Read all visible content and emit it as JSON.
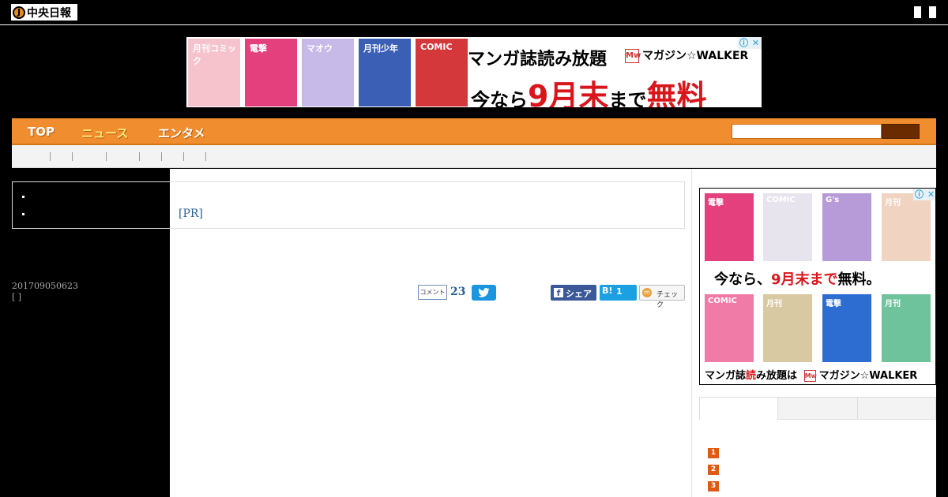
{
  "header": {
    "logo_mark": "J",
    "logo_text": "中央日報"
  },
  "top_ad": {
    "covers": [
      {
        "label": "月刊コミック",
        "color": "#f6c3cd"
      },
      {
        "label": "電撃",
        "color": "#e3407d"
      },
      {
        "label": "マオウ",
        "color": "#c7b9e8"
      },
      {
        "label": "月刊少年",
        "color": "#3c5fb6"
      },
      {
        "label": "COMIC",
        "color": "#d5383a"
      }
    ],
    "headline": "マンガ誌読み放題",
    "brand_mark": "Mw",
    "brand": "マガジン☆WALKER",
    "subline_prefix": "今なら",
    "subline_highlight": "9月末",
    "subline_mid": "まで",
    "subline_emph": "無料",
    "adchoice_info": "ⓘ",
    "adchoice_close": "✕"
  },
  "nav": {
    "items": [
      "TOP",
      "ニュース",
      "エンタメ"
    ],
    "active_index": 1
  },
  "article": {
    "pr_label": "[PR]",
    "date": "201709050623",
    "bracket": "[ ]",
    "comment_label": "コメント",
    "comment_count": "23",
    "fb_label": "シェア",
    "fb_mark": "f",
    "hatena_mark": "B!",
    "hatena_count": "1",
    "mixi_mark": "m",
    "mixi_label": "チェック"
  },
  "side_ad": {
    "covers_top": [
      {
        "label": "電撃",
        "color": "#e3407d"
      },
      {
        "label": "COMIC",
        "color": "#e7e4ee"
      },
      {
        "label": "G's",
        "color": "#b79ad8"
      },
      {
        "label": "月刊",
        "color": "#f0d3c1"
      }
    ],
    "covers_bottom": [
      {
        "label": "COMIC",
        "color": "#ef7ba6"
      },
      {
        "label": "月刊",
        "color": "#d9c9a2"
      },
      {
        "label": "電撃",
        "color": "#2d6cd0"
      },
      {
        "label": "月刊",
        "color": "#6fc39c"
      }
    ],
    "line1_prefix": "今なら、",
    "line1_highlight": "9月末まで",
    "line1_suffix": "無料。",
    "line2_prefix": "マンガ誌",
    "line2_highlight": "読",
    "line2_suffix": "み放題は",
    "brand_mark": "Mw",
    "brand": "マガジン☆WALKER",
    "adchoice_info": "ⓘ",
    "adchoice_close": "✕"
  },
  "ranking": {
    "numbers": [
      "1",
      "2",
      "3"
    ]
  },
  "colors": {
    "nav_orange": "#f08d2e",
    "rank_orange": "#e05a14",
    "link_blue": "#2b5f8f"
  }
}
